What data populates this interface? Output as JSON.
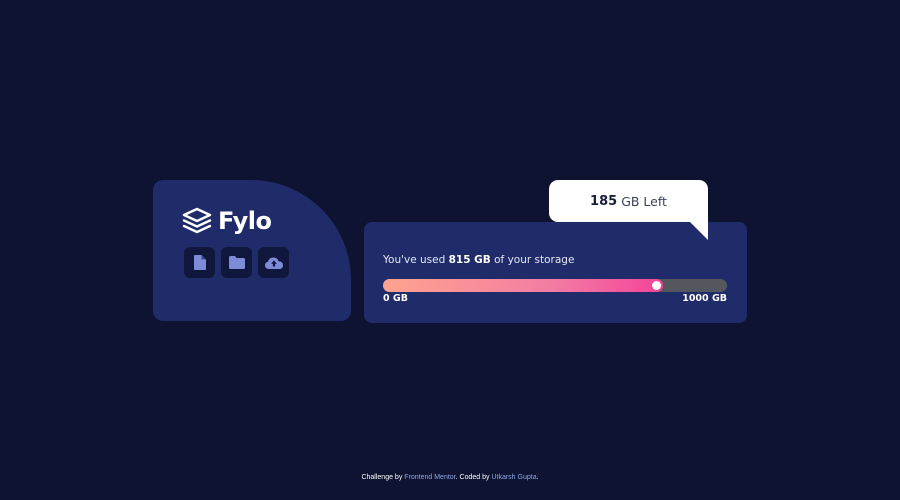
{
  "brand": {
    "name": "Fylo",
    "logo_icon": "stacked-layers-icon"
  },
  "file_actions": [
    {
      "icon": "document-icon",
      "name": "upload-document-button"
    },
    {
      "icon": "folder-icon",
      "name": "upload-folder-button"
    },
    {
      "icon": "cloud-upload-icon",
      "name": "upload-cloud-button"
    }
  ],
  "storage": {
    "usage_prefix": "You've used ",
    "used_value": "815 GB",
    "usage_suffix": " of your storage",
    "used_fraction": 0.815,
    "min_label": "0 GB",
    "max_label": "1000 GB"
  },
  "remaining": {
    "amount": "185",
    "label": "GB Left"
  },
  "footer": {
    "challenge_prefix": "Challenge by ",
    "challenge_link": "Frontend Mentor",
    "coded_prefix": ". Coded by ",
    "coded_link": "Utkarsh Gupta",
    "suffix": "."
  },
  "colors": {
    "background": "#0d1330",
    "card": "#202c69",
    "button": "#0f173c",
    "icon": "#7d8bd9",
    "gradient_start": "#fea38f",
    "gradient_end": "#f44398",
    "track": "#54575e",
    "link": "#8fa7e8"
  }
}
